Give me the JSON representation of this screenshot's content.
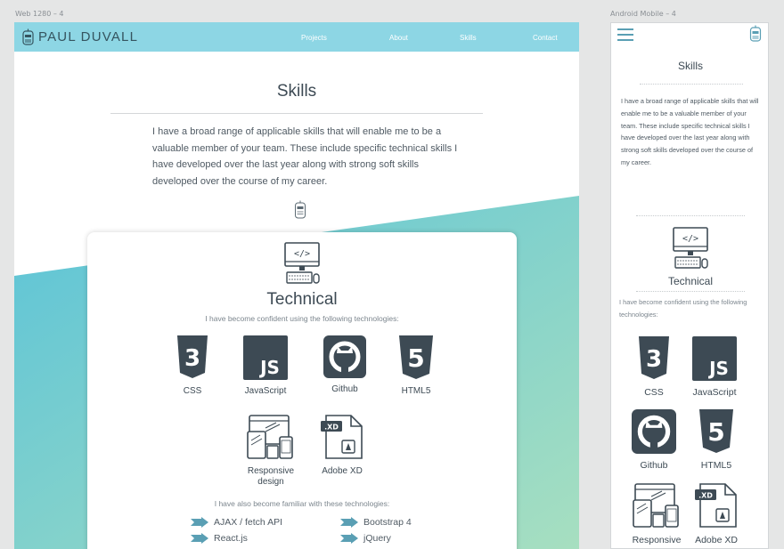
{
  "artboards": {
    "desktop_label": "Web 1280 – 4",
    "mobile_label": "Android Mobile – 4"
  },
  "desktop": {
    "brand": "PAUL DUVALL",
    "nav": [
      "Projects",
      "About",
      "Skills",
      "Contact"
    ],
    "title": "Skills",
    "intro": "I have a broad range of applicable skills that will enable me to be a valuable member of your team. These include specific technical skills I have developed over the last year along with strong soft skills developed over the course of my career.",
    "card": {
      "title": "Technical",
      "subtitle": "I have become confident using the following technologies:",
      "techs": [
        {
          "name": "CSS",
          "icon": "css3-icon"
        },
        {
          "name": "JavaScript",
          "icon": "javascript-icon"
        },
        {
          "name": "Github",
          "icon": "github-icon"
        },
        {
          "name": "HTML5",
          "icon": "html5-icon"
        },
        {
          "name": "Responsive design",
          "icon": "responsive-design-icon"
        },
        {
          "name": "Adobe XD",
          "icon": "adobe-xd-file-icon"
        }
      ],
      "familiar_heading": "I have also become familiar with these technologies:",
      "familiar": [
        "AJAX / fetch API",
        "Bootstrap 4",
        "React.js",
        "jQuery"
      ]
    }
  },
  "mobile": {
    "title": "Skills",
    "intro": "I have a broad range of applicable skills that will enable me to be a valuable member of your team. These include specific technical skills I have developed over the last year along with strong soft skills developed over the course of my career.",
    "tech_title": "Technical",
    "tech_subtitle": "I have become confident using the following technologies:",
    "techs": [
      "CSS",
      "JavaScript",
      "Github",
      "HTML5",
      "Responsive",
      "Adobe XD"
    ]
  },
  "colors": {
    "nav_bar": "#8dd6e4",
    "icon_dark": "#3d4a54",
    "gradient_start": "#5bc3d8",
    "gradient_end": "#a7dfc0"
  }
}
